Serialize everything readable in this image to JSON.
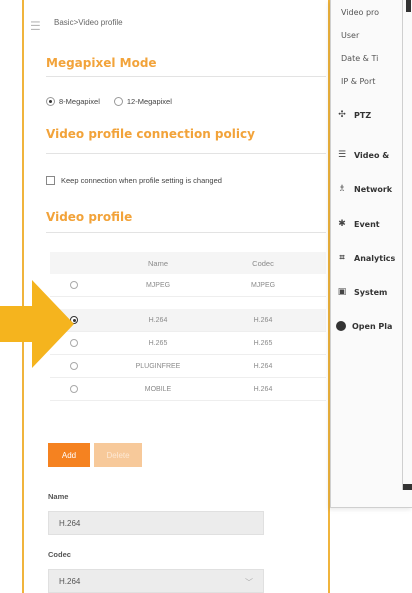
{
  "breadcrumb": "Basic>Video profile",
  "sections": {
    "megapixel": "Megapixel Mode",
    "policy": "Video profile connection policy",
    "profile": "Video profile"
  },
  "megapixel_options": [
    {
      "label": "8-Megapixel",
      "checked": true
    },
    {
      "label": "12-Megapixel",
      "checked": false
    }
  ],
  "policy_checkbox": "Keep connection when profile setting is changed",
  "table": {
    "headers": {
      "name": "Name",
      "codec": "Codec"
    },
    "rows": [
      {
        "name": "MJPEG",
        "codec": "MJPEG",
        "selected": false
      },
      {
        "name": "H.264",
        "codec": "H.264",
        "selected": true
      },
      {
        "name": "H.265",
        "codec": "H.265",
        "selected": false
      },
      {
        "name": "PLUGINFREE",
        "codec": "H.264",
        "selected": false
      },
      {
        "name": "MOBILE",
        "codec": "H.264",
        "selected": false
      }
    ]
  },
  "buttons": {
    "add": "Add",
    "delete": "Delete"
  },
  "form": {
    "name_label": "Name",
    "name_value": "H.264",
    "codec_label": "Codec",
    "codec_value": "H.264"
  },
  "side_submenu": [
    "Video pro",
    "User",
    "Date & Ti",
    "IP & Port"
  ],
  "side_menu": [
    {
      "label": "PTZ",
      "icon": "ptz-icon"
    },
    {
      "label": "Video &",
      "icon": "video-audio-icon"
    },
    {
      "label": "Network",
      "icon": "network-icon"
    },
    {
      "label": "Event",
      "icon": "event-icon"
    },
    {
      "label": "Analytics",
      "icon": "analytics-icon"
    },
    {
      "label": "System",
      "icon": "system-icon"
    },
    {
      "label": "Open Pla",
      "icon": "open-platform-icon"
    }
  ],
  "colors": {
    "accent": "#f2a33a",
    "button": "#f58220",
    "arrow": "#f5b41e",
    "border": "#f0b43c"
  }
}
